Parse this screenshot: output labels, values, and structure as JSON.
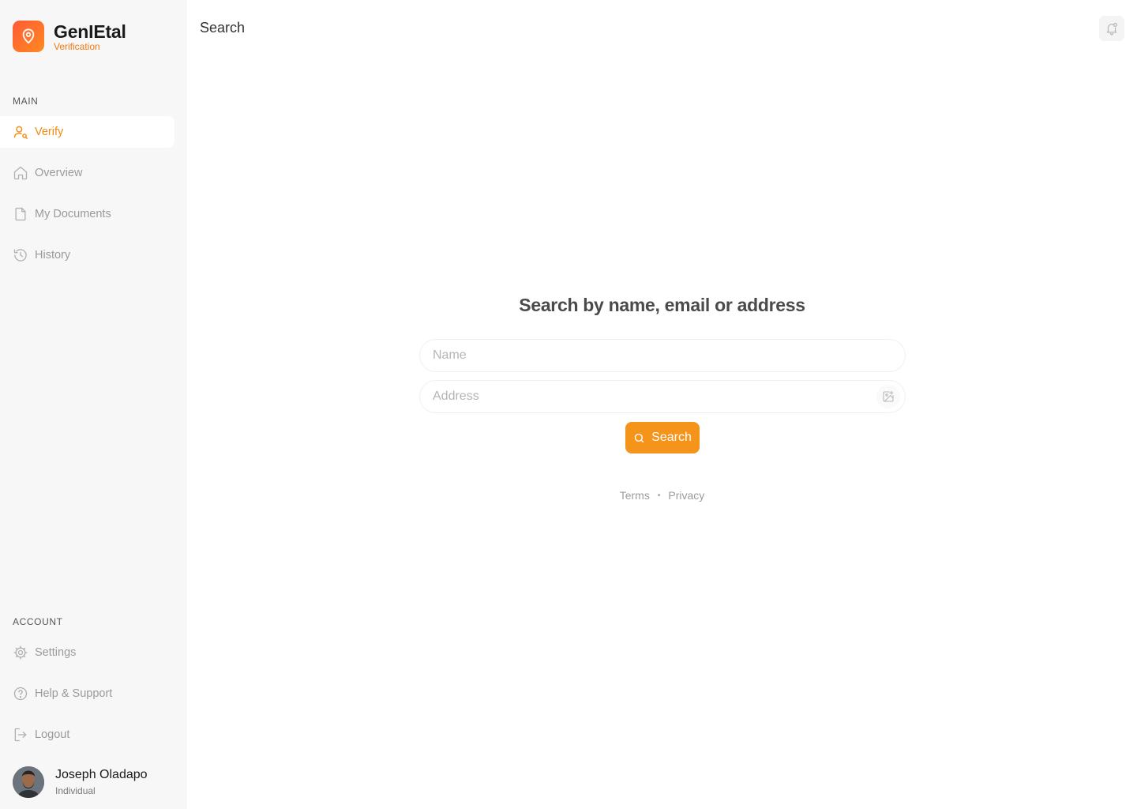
{
  "brand": {
    "name": "GenIEtal",
    "subtitle": "Verification",
    "accent": "#F5941A",
    "gradient": [
      "#FF5A36",
      "#FF8A1F"
    ]
  },
  "sidebar": {
    "main_label": "MAIN",
    "main_items": [
      {
        "label": "Verify",
        "icon": "user-search-icon",
        "active": true
      },
      {
        "label": "Overview",
        "icon": "home-icon",
        "active": false
      },
      {
        "label": "My Documents",
        "icon": "document-icon",
        "active": false
      },
      {
        "label": "History",
        "icon": "history-icon",
        "active": false
      }
    ],
    "account_label": "ACCOUNT",
    "account_items": [
      {
        "label": "Settings",
        "icon": "gear-icon"
      },
      {
        "label": "Help & Support",
        "icon": "help-circle-icon"
      },
      {
        "label": "Logout",
        "icon": "logout-icon"
      }
    ],
    "user": {
      "name": "Joseph Oladapo",
      "role": "Individual"
    }
  },
  "topbar": {
    "title": "Search",
    "notification_icon": "bell-icon"
  },
  "main": {
    "heading": "Search by name, email or address",
    "name_field": {
      "placeholder": "Name",
      "value": ""
    },
    "address_field": {
      "placeholder": "Address",
      "value": "",
      "icon": "image-add-icon"
    },
    "search_button": {
      "label": "Search",
      "icon": "search-icon"
    },
    "footer": {
      "terms": "Terms",
      "separator": "•",
      "privacy": "Privacy"
    }
  }
}
